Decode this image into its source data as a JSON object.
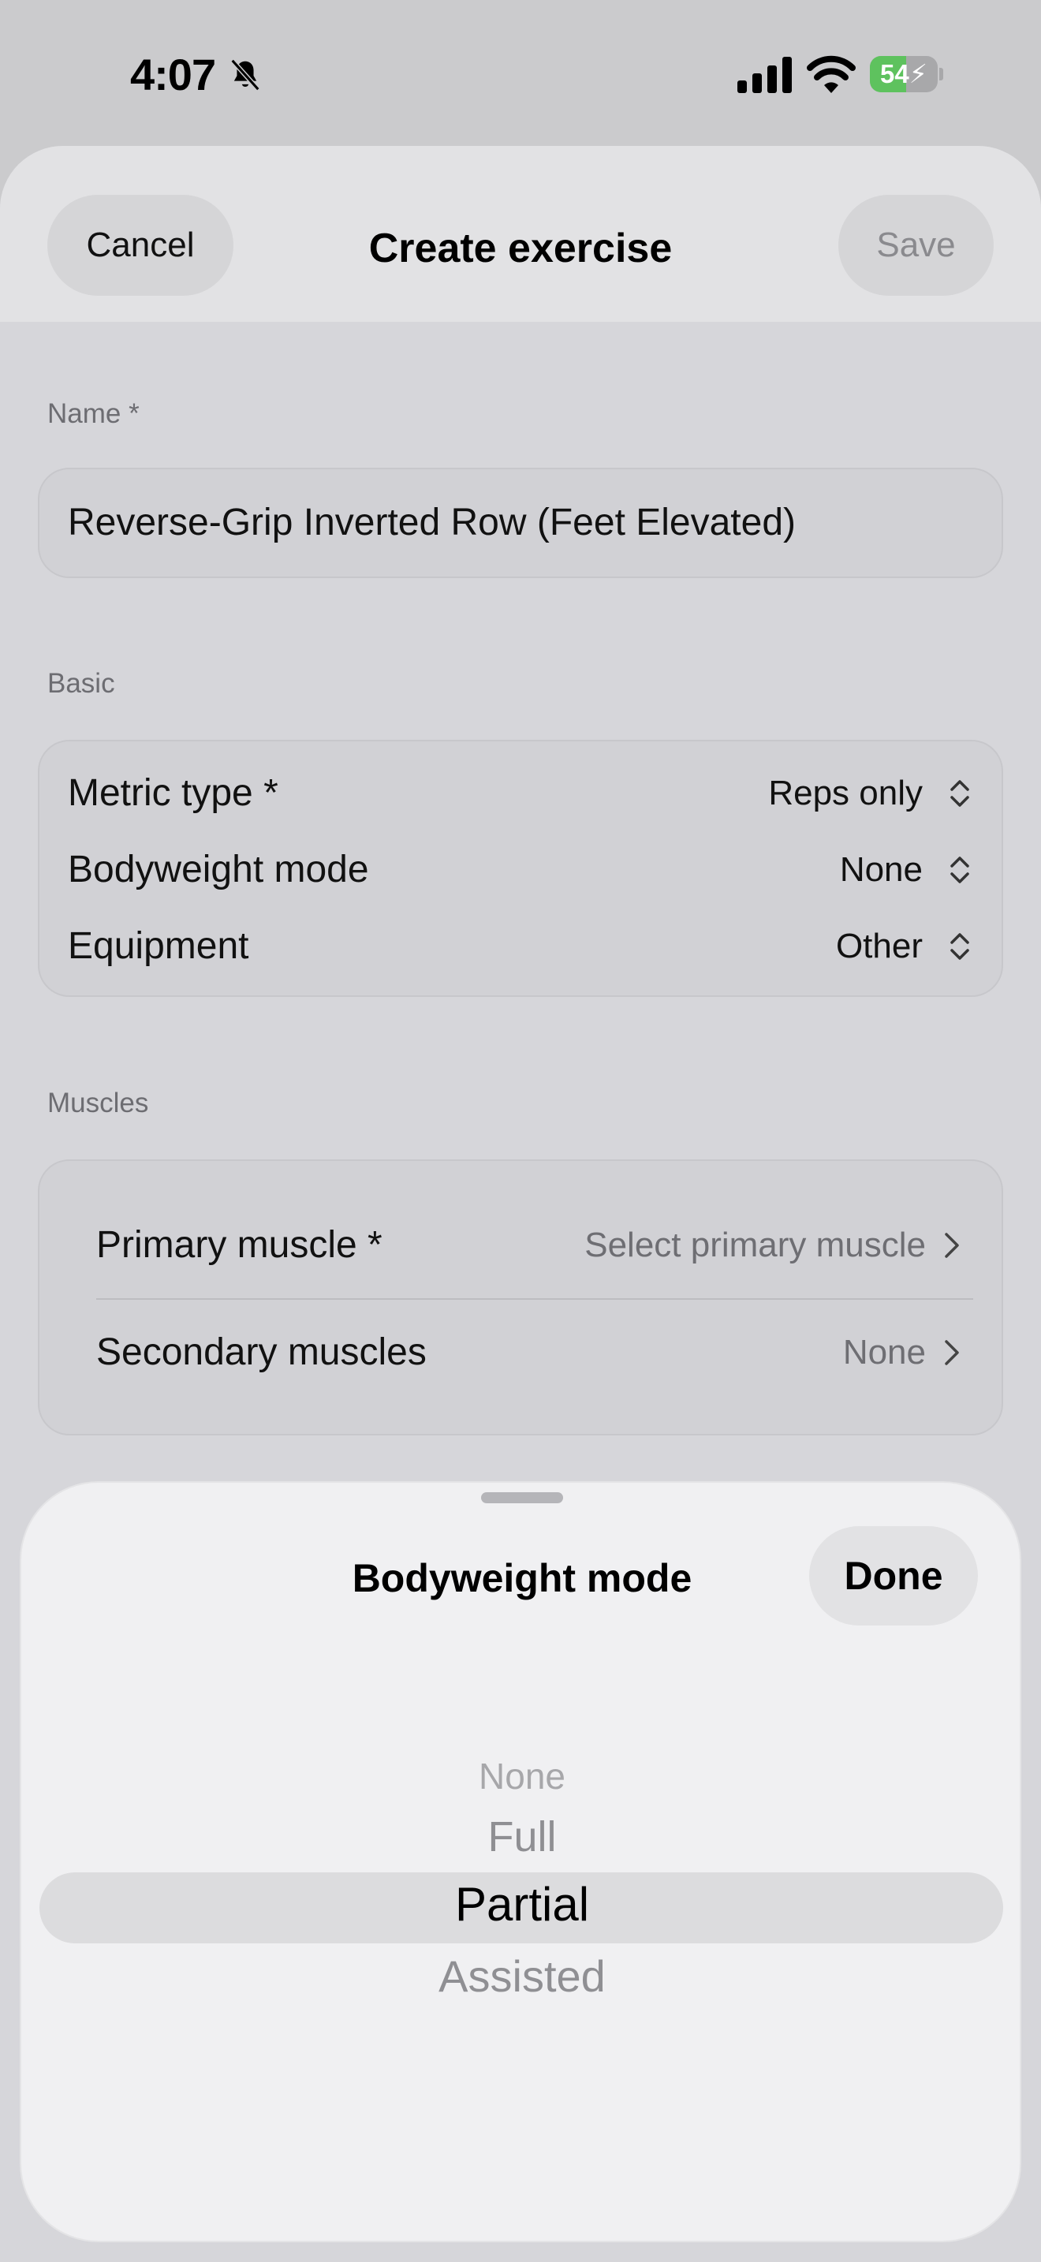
{
  "status_bar": {
    "time": "4:07",
    "battery_level": "54",
    "battery_fraction": 0.54,
    "icons": [
      "bell-slash-icon",
      "cellular-signal-icon",
      "wifi-icon",
      "battery-charging-icon"
    ]
  },
  "nav": {
    "cancel_label": "Cancel",
    "title": "Create exercise",
    "save_label": "Save"
  },
  "name_section": {
    "label": "Name *",
    "value": "Reverse-Grip Inverted Row (Feet Elevated)"
  },
  "basic_section": {
    "label": "Basic",
    "rows": [
      {
        "label": "Metric type *",
        "value": "Reps only"
      },
      {
        "label": "Bodyweight mode",
        "value": "None"
      },
      {
        "label": "Equipment",
        "value": "Other"
      }
    ]
  },
  "muscles_section": {
    "label": "Muscles",
    "rows": [
      {
        "label": "Primary muscle *",
        "value": "Select primary muscle"
      },
      {
        "label": "Secondary muscles",
        "value": "None"
      }
    ]
  },
  "picker": {
    "title": "Bodyweight mode",
    "done_label": "Done",
    "options": [
      "None",
      "Full",
      "Partial",
      "Assisted"
    ],
    "selected": "Partial"
  },
  "colors": {
    "background": "#cbcbcd",
    "sheet": "#d6d6da",
    "picker_bg": "#f0f0f2",
    "battery_green": "#5ec25e"
  }
}
